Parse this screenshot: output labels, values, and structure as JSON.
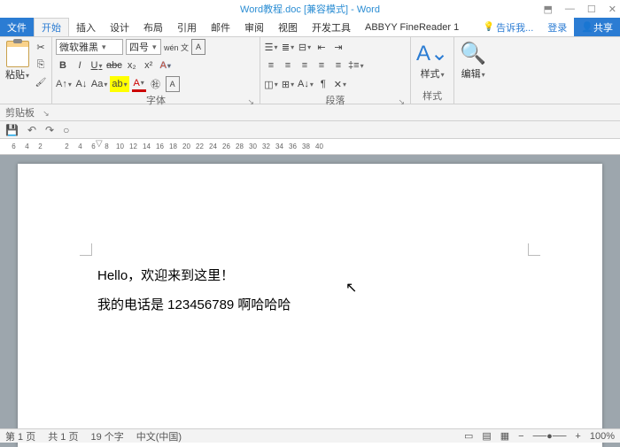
{
  "title": "Word教程.doc [兼容模式] - Word",
  "tabs": {
    "file": "文件",
    "home": "开始",
    "insert": "插入",
    "design": "设计",
    "layout": "布局",
    "references": "引用",
    "mailings": "邮件",
    "review": "审阅",
    "view": "视图",
    "devtools": "开发工具",
    "finereader": "ABBYY FineReader 1",
    "tellme": "告诉我...",
    "login": "登录",
    "share": "共享"
  },
  "clipboard": {
    "paste": "粘贴",
    "groupLabel": "剪贴板"
  },
  "font": {
    "name": "微软雅黑",
    "size": "四号",
    "wen": "wén 文",
    "grow": "A",
    "bold": "B",
    "italic": "I",
    "underline": "U",
    "strike": "abc",
    "sub": "x₂",
    "sup": "x²",
    "effects": "A",
    "highlight": "ab",
    "color": "A",
    "caseBtn": "Aa",
    "circled": "㊓",
    "border": "A",
    "groupLabel": "字体"
  },
  "paragraph": {
    "groupLabel": "段落"
  },
  "styles": {
    "label": "样式"
  },
  "editing": {
    "label": "编辑"
  },
  "qat": {
    "save": "💾",
    "undo": "↶",
    "redo": "↷",
    "more": "○"
  },
  "ruler": [
    "6",
    "4",
    "2",
    "",
    "2",
    "4",
    "6",
    "8",
    "10",
    "12",
    "14",
    "16",
    "18",
    "20",
    "22",
    "24",
    "26",
    "28",
    "30",
    "32",
    "34",
    "36",
    "38",
    "40"
  ],
  "doc": {
    "line1": "Hello，欢迎来到这里！",
    "line2": "我的电话是 123456789 啊哈哈哈"
  },
  "status": {
    "page": "第 1 页",
    "pages": "共 1 页",
    "words": "19 个字",
    "lang": "中文(中国)",
    "zoom": "100%"
  }
}
